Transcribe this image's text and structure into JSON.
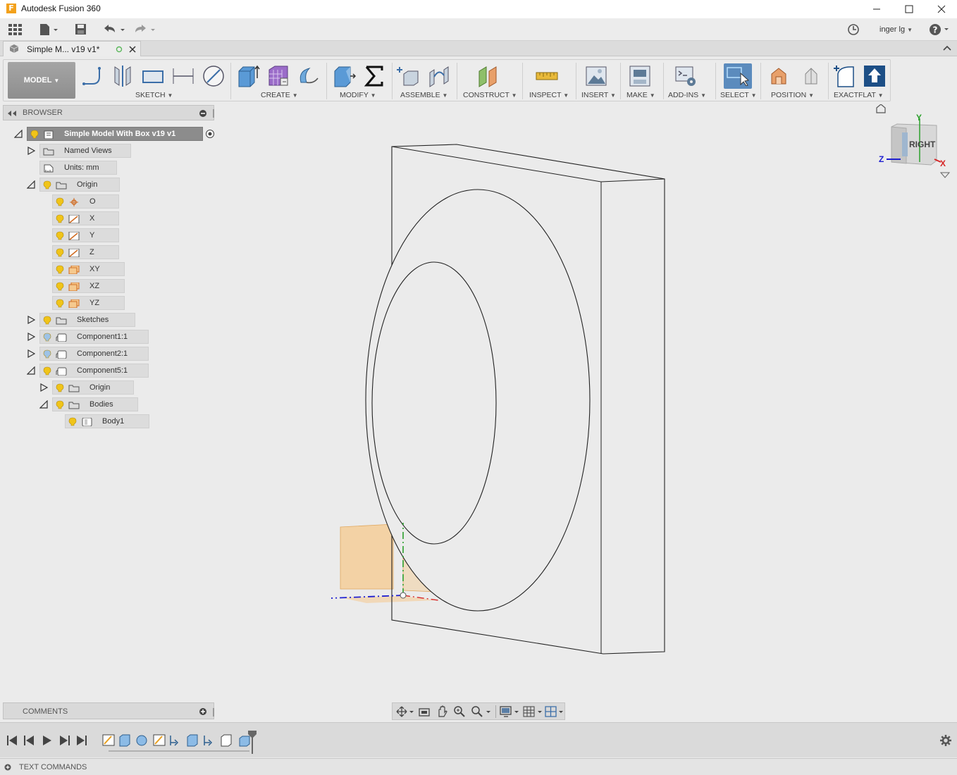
{
  "app": {
    "title": "Autodesk Fusion 360"
  },
  "window_controls": [
    "minimize-icon",
    "maximize-icon",
    "close-icon"
  ],
  "quick_access": {
    "user": "inger lg"
  },
  "document_tab": {
    "label": "Simple M... v19 v1*"
  },
  "toolbar": {
    "workspace": "MODEL",
    "groups": [
      {
        "label": "SKETCH"
      },
      {
        "label": "CREATE"
      },
      {
        "label": "MODIFY"
      },
      {
        "label": "ASSEMBLE"
      },
      {
        "label": "CONSTRUCT"
      },
      {
        "label": "INSPECT"
      },
      {
        "label": "INSERT"
      },
      {
        "label": "MAKE"
      },
      {
        "label": "ADD-INS"
      },
      {
        "label": "SELECT"
      },
      {
        "label": "POSITION"
      },
      {
        "label": "EXACTFLAT"
      }
    ]
  },
  "browser": {
    "title": "BROWSER",
    "nodes": [
      {
        "label": "Simple Model With Box v19 v1"
      },
      {
        "label": "Named Views"
      },
      {
        "label": "Units: mm"
      },
      {
        "label": "Origin"
      },
      {
        "label": "O"
      },
      {
        "label": "X"
      },
      {
        "label": "Y"
      },
      {
        "label": "Z"
      },
      {
        "label": "XY"
      },
      {
        "label": "XZ"
      },
      {
        "label": "YZ"
      },
      {
        "label": "Sketches"
      },
      {
        "label": "Component1:1"
      },
      {
        "label": "Component2:1"
      },
      {
        "label": "Component5:1"
      },
      {
        "label": "Origin"
      },
      {
        "label": "Bodies"
      },
      {
        "label": "Body1"
      }
    ]
  },
  "viewcube": {
    "face": "RIGHT",
    "axes": [
      "Y",
      "Z",
      "X"
    ]
  },
  "comments": {
    "title": "COMMENTS"
  },
  "text_commands": {
    "title": "TEXT COMMANDS"
  },
  "colors": {
    "accent": "#5b8bbd",
    "origin_plane": "#f5c98e",
    "bulb": "#f0c419"
  }
}
